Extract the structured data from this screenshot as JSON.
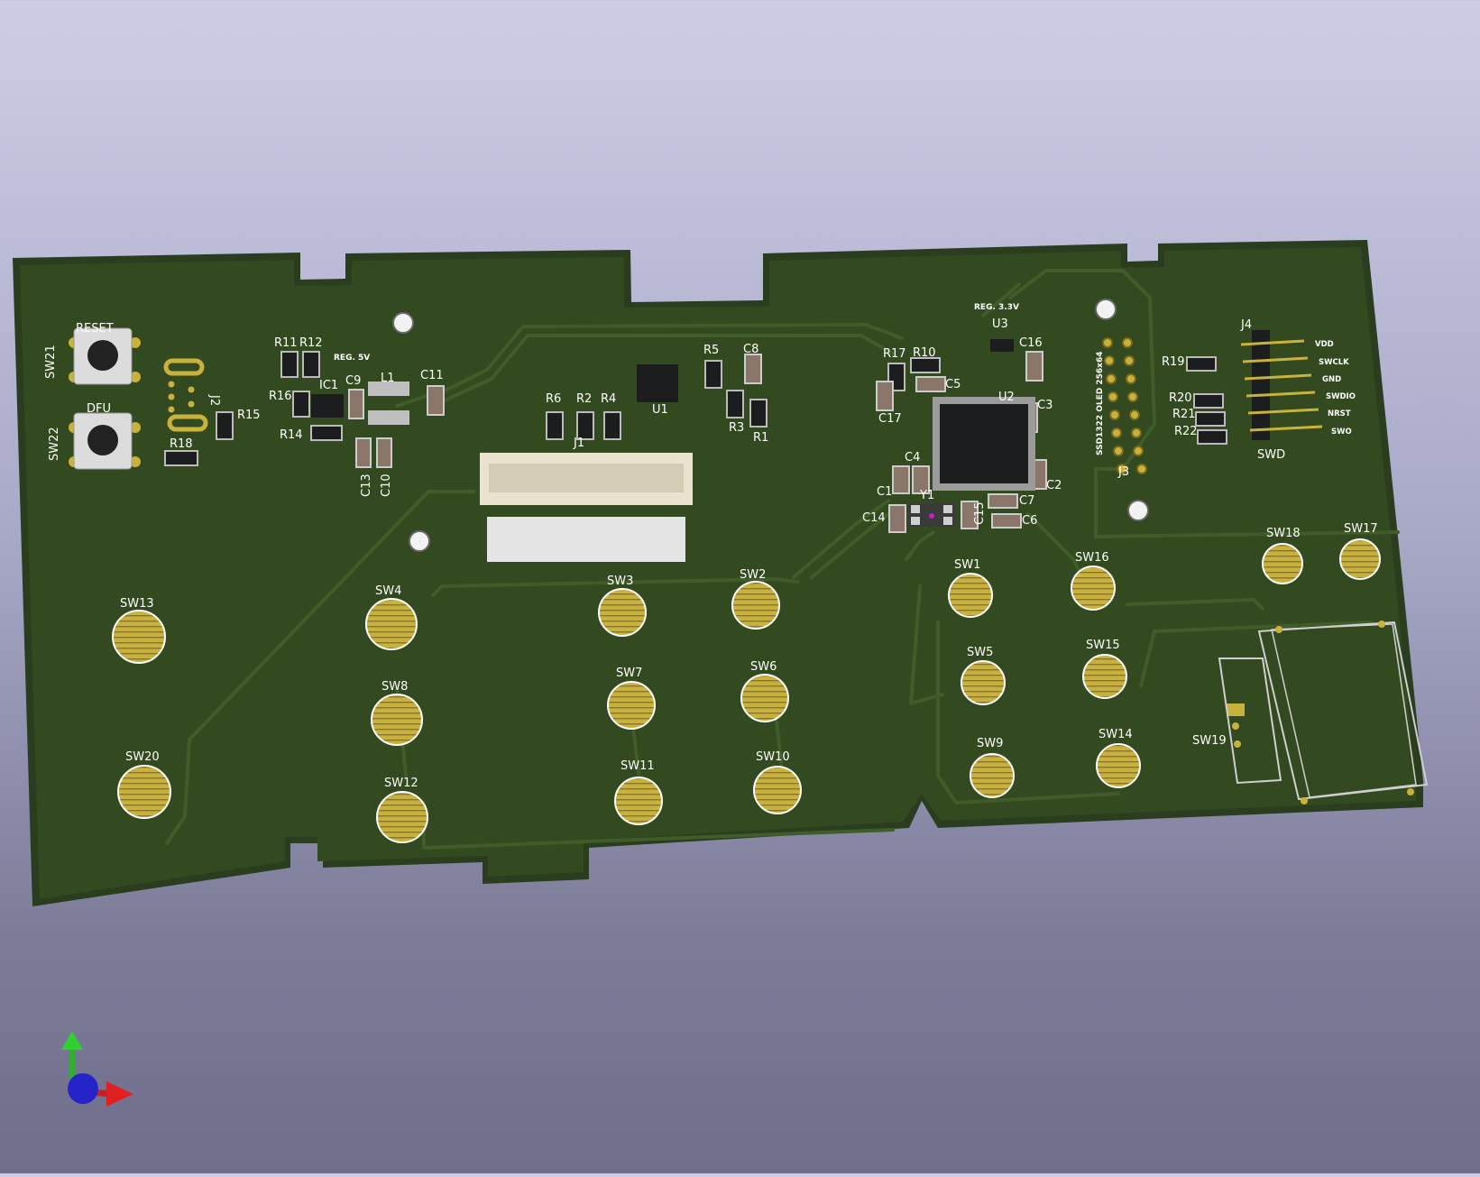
{
  "colors": {
    "board_edge": "#2a3d1f",
    "board": "#33491f",
    "trace": "#3f5c29",
    "pad_gold": "#c9b23c",
    "silk": "#ffffff",
    "component_body": "#1b1d1f",
    "capacitor_body": "#8a7668"
  },
  "silkscreen": {
    "reset_label": "RESET",
    "dfu_label": "DFU",
    "reg5v_label": "REG. 5V",
    "reg33v_label": "REG. 3.3V",
    "oled_label": "SSD1322 OLED 256x64",
    "j2_label": "J2",
    "j3_label": "J3",
    "swd_header_label": "SWD",
    "swd_pins": [
      "VDD",
      "SWCLK",
      "GND",
      "SWDIO",
      "NRST",
      "SWO"
    ]
  },
  "references": {
    "sw21": "SW21",
    "sw22": "SW22",
    "r11": "R11",
    "r12": "R12",
    "r16": "R16",
    "r14": "R14",
    "r15": "R15",
    "r18": "R18",
    "ic1": "IC1",
    "c9": "C9",
    "l1": "L1",
    "c11": "C11",
    "c13": "C13",
    "c10": "C10",
    "r6": "R6",
    "r2": "R2",
    "r4": "R4",
    "j1": "J1",
    "u1": "U1",
    "r5": "R5",
    "c8": "C8",
    "r3": "R3",
    "r1": "R1",
    "r17": "R17",
    "r10": "R10",
    "c5": "C5",
    "c17": "C17",
    "u3": "U3",
    "c16": "C16",
    "u2": "U2",
    "c3": "C3",
    "c2": "C2",
    "c4": "C4",
    "c1": "C1",
    "y1": "Y1",
    "c14": "C14",
    "c15": "C15",
    "c7": "C7",
    "c6": "C6",
    "j4": "J4",
    "r19": "R19",
    "r20": "R20",
    "r21": "R21",
    "r22": "R22",
    "sw19": "SW19"
  },
  "touch_buttons": [
    "SW1",
    "SW2",
    "SW3",
    "SW4",
    "SW5",
    "SW6",
    "SW7",
    "SW8",
    "SW9",
    "SW10",
    "SW11",
    "SW12",
    "SW13",
    "SW14",
    "SW15",
    "SW16",
    "SW17",
    "SW18",
    "SW20"
  ]
}
